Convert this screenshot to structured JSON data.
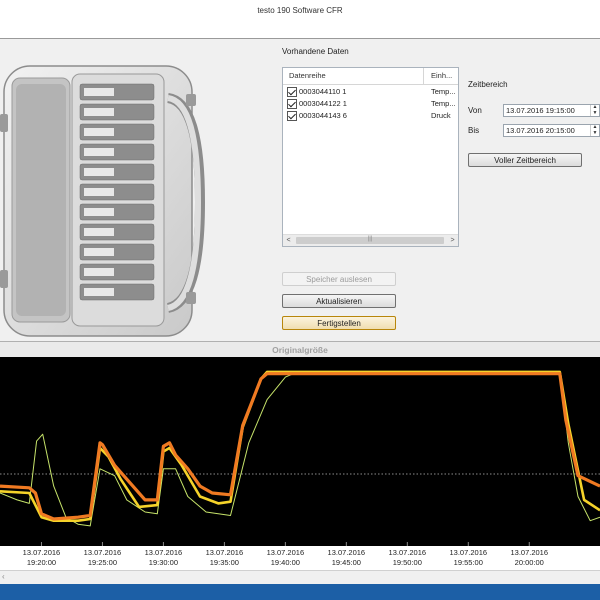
{
  "window": {
    "title": "testo 190 Software CFR"
  },
  "data_panel": {
    "heading": "Vorhandene Daten",
    "columns": [
      "Datenreihe",
      "Einh..."
    ],
    "rows": [
      {
        "checked": true,
        "name": "0003044110 1",
        "unit": "Temp..."
      },
      {
        "checked": true,
        "name": "0003044122 1",
        "unit": "Temp..."
      },
      {
        "checked": true,
        "name": "0003044143 6",
        "unit": "Druck"
      }
    ],
    "scroll_left": "<",
    "scroll_right": ">",
    "scroll_grip": "|||"
  },
  "buttons": {
    "read_memory": "Speicher auslesen",
    "refresh": "Aktualisieren",
    "finish": "Fertigstellen",
    "full_range": "Voller Zeitbereich"
  },
  "time_range": {
    "heading": "Zeitbereich",
    "from_label": "Von",
    "from_value": "13.07.2016 19:15:00",
    "to_label": "Bis",
    "to_value": "13.07.2016 20:15:00"
  },
  "chart_header": "Originalgröße",
  "colors": {
    "series_orange": "#f07a22",
    "series_yellow": "#f5d32a",
    "series_lightgreen": "#c6e36a",
    "chart_bg": "#000000",
    "taskbar": "#1c5fa6"
  },
  "chart_data": {
    "type": "line",
    "x_ticks": [
      [
        "13.07.2016",
        "19:20:00"
      ],
      [
        "13.07.2016",
        "19:25:00"
      ],
      [
        "13.07.2016",
        "19:30:00"
      ],
      [
        "13.07.2016",
        "19:35:00"
      ],
      [
        "13.07.2016",
        "19:40:00"
      ],
      [
        "13.07.2016",
        "19:45:00"
      ],
      [
        "13.07.2016",
        "19:50:00"
      ],
      [
        "13.07.2016",
        "19:55:00"
      ],
      [
        "13.07.2016",
        "20:00:00"
      ]
    ],
    "x_tick_minutes": [
      20,
      25,
      30,
      35,
      40,
      45,
      50,
      55,
      60
    ],
    "xlim_minutes": [
      16.6,
      65.8
    ],
    "ylim_fraction": [
      0,
      1
    ],
    "reference_level": 0.37,
    "series": [
      {
        "color": "#f07a22",
        "points": [
          [
            16.6,
            0.3
          ],
          [
            19,
            0.29
          ],
          [
            19.5,
            0.26
          ],
          [
            20,
            0.14
          ],
          [
            21,
            0.11
          ],
          [
            23,
            0.12
          ],
          [
            24,
            0.13
          ],
          [
            24.8,
            0.55
          ],
          [
            25,
            0.54
          ],
          [
            26,
            0.42
          ],
          [
            27,
            0.34
          ],
          [
            28.5,
            0.22
          ],
          [
            29.5,
            0.22
          ],
          [
            30,
            0.53
          ],
          [
            30.5,
            0.55
          ],
          [
            31,
            0.48
          ],
          [
            32,
            0.4
          ],
          [
            33,
            0.3
          ],
          [
            34,
            0.26
          ],
          [
            35.5,
            0.25
          ],
          [
            36.5,
            0.65
          ],
          [
            38,
            0.92
          ],
          [
            38.5,
            0.95
          ],
          [
            43,
            0.95
          ],
          [
            50,
            0.95
          ],
          [
            55,
            0.95
          ],
          [
            60,
            0.95
          ],
          [
            62.5,
            0.95
          ],
          [
            63,
            0.68
          ],
          [
            64,
            0.36
          ],
          [
            65.8,
            0.3
          ]
        ]
      },
      {
        "color": "#f5d32a",
        "points": [
          [
            16.6,
            0.27
          ],
          [
            19,
            0.26
          ],
          [
            20,
            0.12
          ],
          [
            21,
            0.1
          ],
          [
            23,
            0.1
          ],
          [
            24,
            0.11
          ],
          [
            24.8,
            0.52
          ],
          [
            25.5,
            0.47
          ],
          [
            26.5,
            0.34
          ],
          [
            28,
            0.18
          ],
          [
            29.5,
            0.19
          ],
          [
            30,
            0.5
          ],
          [
            30.5,
            0.52
          ],
          [
            31.5,
            0.42
          ],
          [
            33,
            0.24
          ],
          [
            34.5,
            0.2
          ],
          [
            35.5,
            0.21
          ],
          [
            36.5,
            0.64
          ],
          [
            38,
            0.92
          ],
          [
            38.5,
            0.96
          ],
          [
            45,
            0.96
          ],
          [
            55,
            0.96
          ],
          [
            62.5,
            0.96
          ],
          [
            63.2,
            0.66
          ],
          [
            64.5,
            0.22
          ],
          [
            65.8,
            0.16
          ]
        ]
      },
      {
        "color": "#c6e36a",
        "points": [
          [
            16.6,
            0.26
          ],
          [
            18,
            0.22
          ],
          [
            19,
            0.2
          ],
          [
            19.6,
            0.56
          ],
          [
            20.1,
            0.6
          ],
          [
            21,
            0.3
          ],
          [
            22,
            0.12
          ],
          [
            23,
            0.08
          ],
          [
            24,
            0.07
          ],
          [
            24.8,
            0.4
          ],
          [
            26,
            0.36
          ],
          [
            27,
            0.22
          ],
          [
            28.5,
            0.15
          ],
          [
            29.5,
            0.14
          ],
          [
            30,
            0.4
          ],
          [
            31,
            0.4
          ],
          [
            32,
            0.24
          ],
          [
            33.5,
            0.15
          ],
          [
            35.5,
            0.13
          ],
          [
            37,
            0.55
          ],
          [
            38.5,
            0.8
          ],
          [
            40,
            0.93
          ],
          [
            41,
            0.96
          ],
          [
            50,
            0.96
          ],
          [
            62.5,
            0.96
          ],
          [
            63.2,
            0.55
          ],
          [
            64,
            0.24
          ],
          [
            65,
            0.1
          ],
          [
            65.8,
            0.12
          ]
        ]
      }
    ]
  }
}
